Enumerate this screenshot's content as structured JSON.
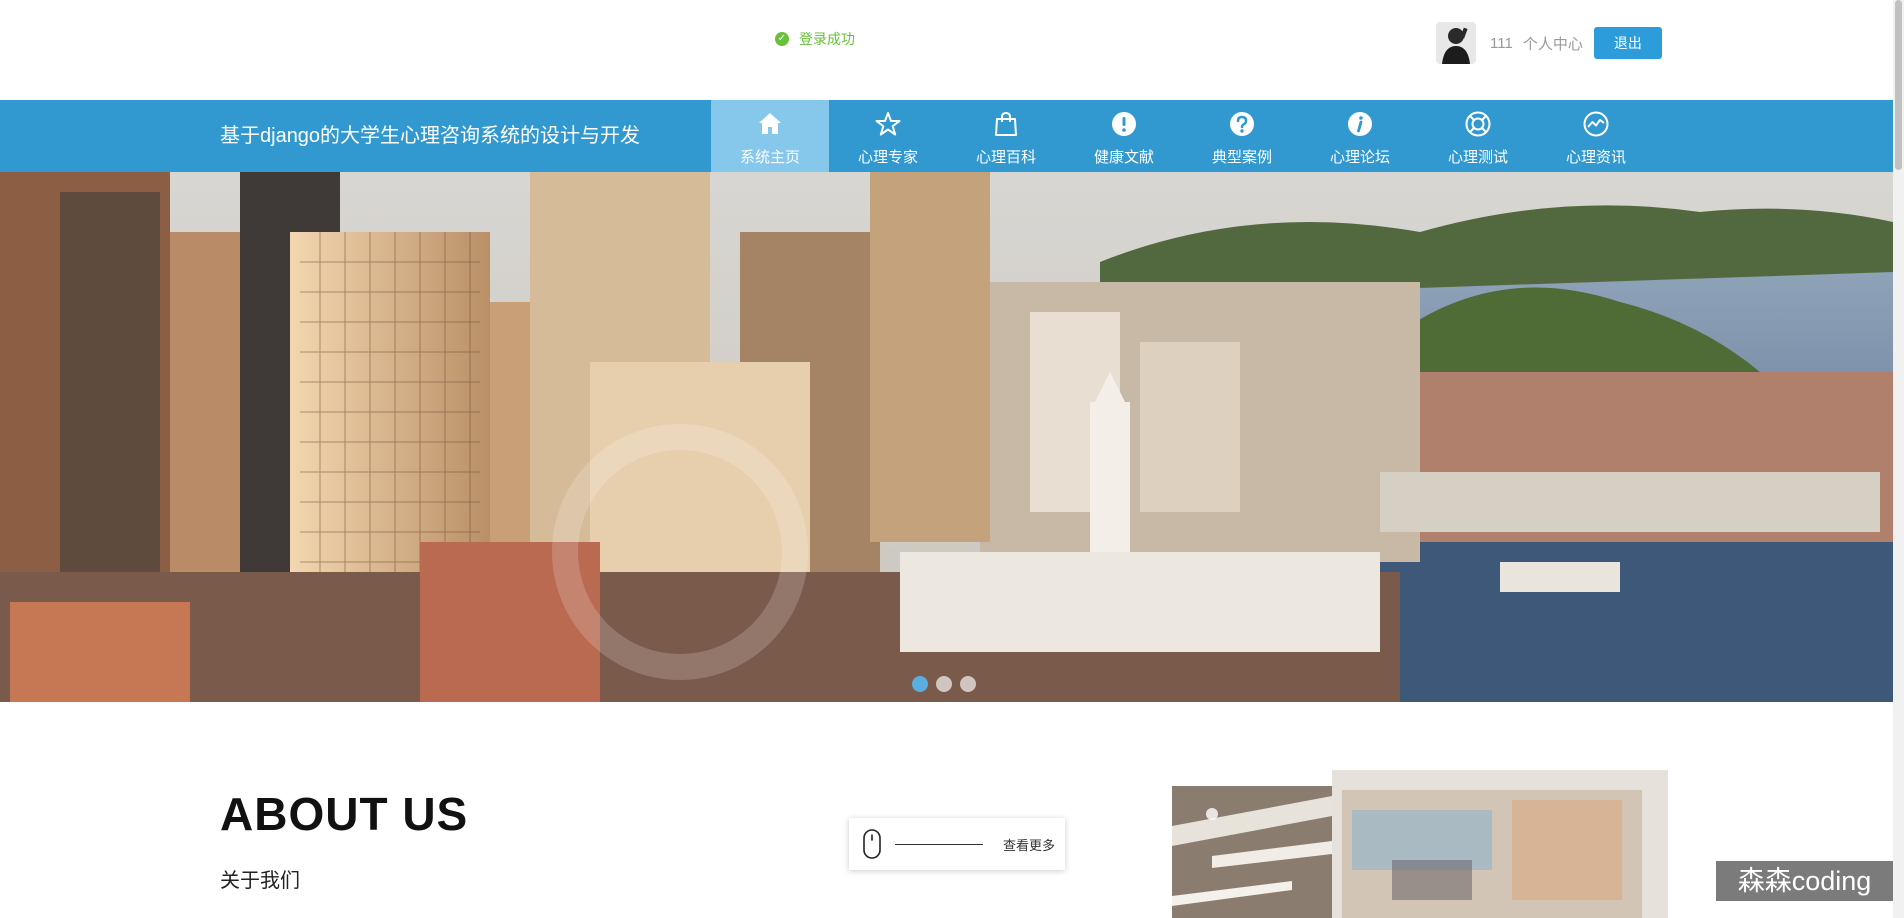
{
  "toast": {
    "icon": "check-circle-icon",
    "text": "登录成功",
    "color": "#67c23a"
  },
  "user": {
    "avatar_icon": "user-avatar-icon",
    "name": "111",
    "center_label": "个人中心",
    "logout_label": "退出"
  },
  "header": {
    "title": "基于django的大学生心理咨询系统的设计与开发",
    "bg_color": "#3199d0",
    "active_color": "#86c7ec"
  },
  "nav": {
    "items": [
      {
        "label": "系统主页",
        "icon": "home-icon",
        "active": true
      },
      {
        "label": "心理专家",
        "icon": "star-icon",
        "active": false
      },
      {
        "label": "心理百科",
        "icon": "shopping-bag-icon",
        "active": false
      },
      {
        "label": "健康文献",
        "icon": "exclamation-circle-icon",
        "active": false
      },
      {
        "label": "典型案例",
        "icon": "question-circle-icon",
        "active": false
      },
      {
        "label": "心理论坛",
        "icon": "info-circle-icon",
        "active": false
      },
      {
        "label": "心理测试",
        "icon": "lifebuoy-icon",
        "active": false
      },
      {
        "label": "心理资讯",
        "icon": "chart-circle-icon",
        "active": false
      }
    ]
  },
  "banner": {
    "image": "city-skyline-photo",
    "slide_count": 3,
    "active_slide": 1
  },
  "about": {
    "title": "ABOUT US",
    "subtitle": "关于我们",
    "more_label": "查看更多",
    "more_icon": "mouse-icon"
  },
  "watermark": "森森coding"
}
